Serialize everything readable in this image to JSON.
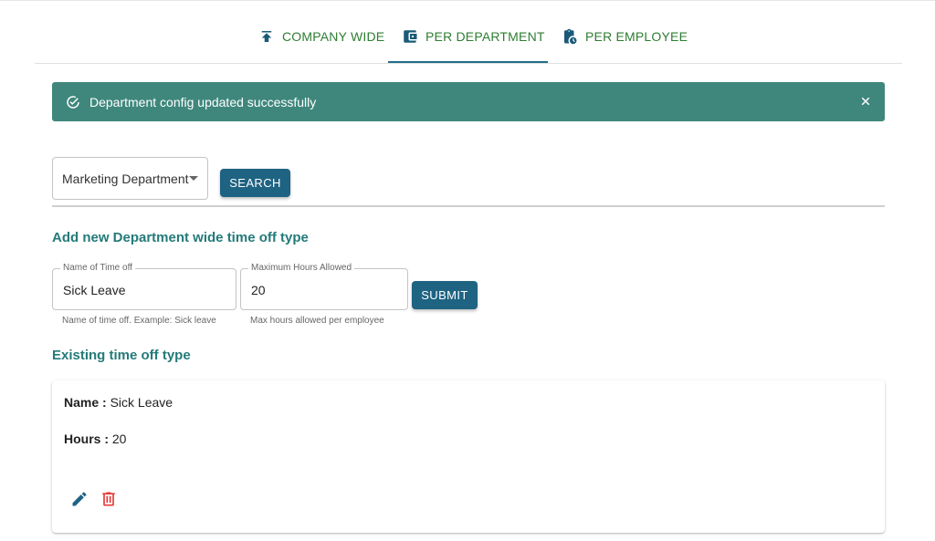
{
  "tabs": [
    {
      "label": "COMPANY WIDE",
      "icon": "upload-icon"
    },
    {
      "label": "PER DEPARTMENT",
      "icon": "wallet-icon",
      "active": true
    },
    {
      "label": "PER EMPLOYEE",
      "icon": "clipboard-clock-icon"
    }
  ],
  "alert": {
    "message": "Department config updated successfully",
    "icon": "check-circle-icon",
    "close_icon": "close-icon",
    "color": "#3f877c"
  },
  "filter": {
    "department_selected": "Marketing Department",
    "search_label": "SEARCH"
  },
  "add_section": {
    "title": "Add new Department wide time off type",
    "name_field": {
      "label": "Name of Time off",
      "value": "Sick Leave",
      "helper": "Name of time off. Example: Sick leave"
    },
    "hours_field": {
      "label": "Maximum Hours Allowed",
      "value": "20",
      "helper": "Max hours allowed per employee"
    },
    "submit_label": "SUBMIT"
  },
  "existing_section": {
    "title": "Existing time off type",
    "items": [
      {
        "name_label": "Name :",
        "name_value": "Sick Leave",
        "hours_label": "Hours :",
        "hours_value": "20",
        "edit_icon": "pencil-icon",
        "delete_icon": "trash-icon"
      }
    ]
  },
  "colors": {
    "accent": "#1f6383",
    "heading": "#237a79",
    "tab_text": "#2e7d32",
    "delete": "#e53935"
  }
}
